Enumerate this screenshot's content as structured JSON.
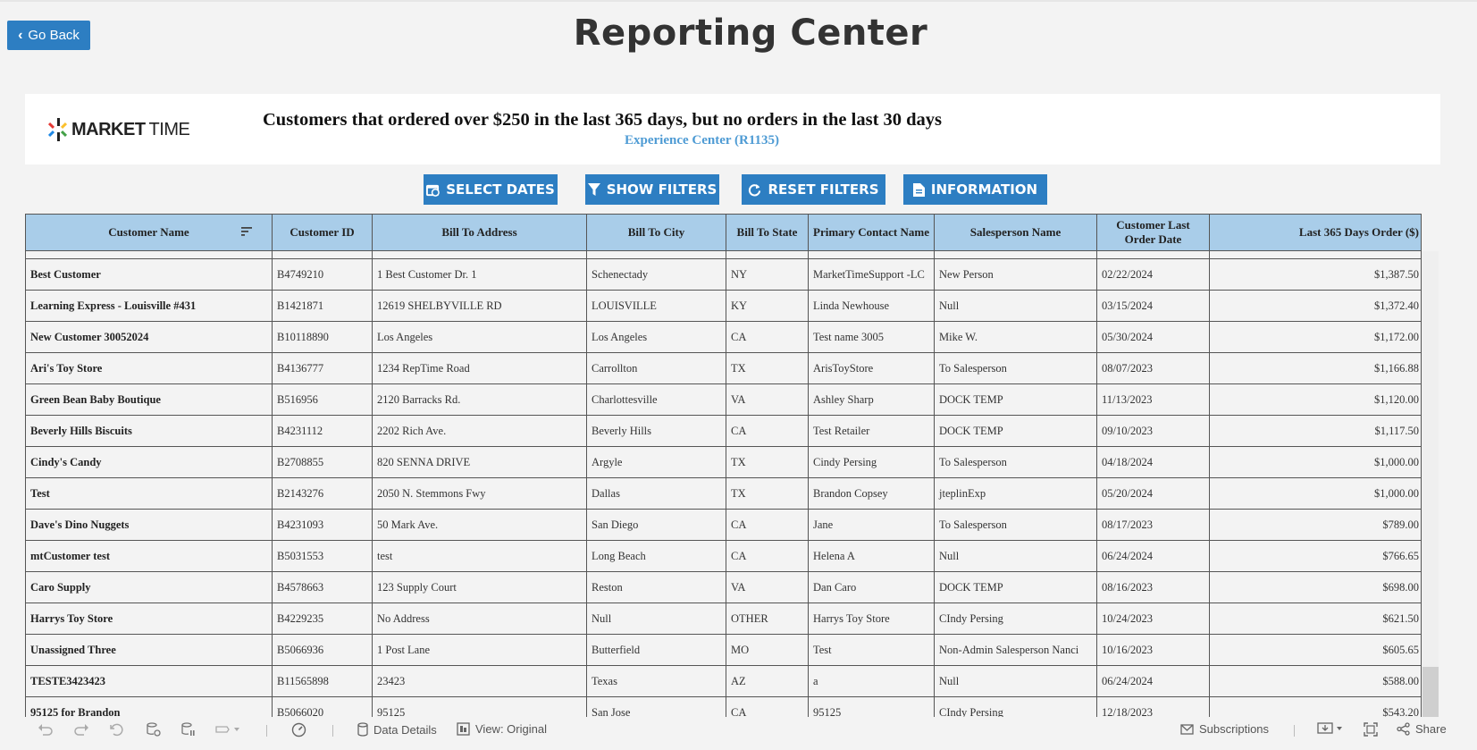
{
  "header": {
    "back_label": "Go Back",
    "title": "Reporting Center"
  },
  "banner": {
    "logo_bold": "MARKET",
    "logo_light": "TIME",
    "title": "Customers that ordered over $250 in the last 365 days, but no orders in the last 30 days",
    "subtitle": "Experience Center (R1135)"
  },
  "actions": {
    "select_dates": "SELECT DATES",
    "show_filters": "SHOW FILTERS",
    "reset_filters": "RESET FILTERS",
    "information": "INFORMATION"
  },
  "table": {
    "columns": [
      "Customer Name",
      "Customer ID",
      "Bill To Address",
      "Bill To City",
      "Bill To State",
      "Primary Contact Name",
      "Salesperson Name",
      "Customer Last Order Date",
      "Last 365 Days Order ($)"
    ],
    "rows": [
      [
        "Best Customer",
        "B4749210",
        "1 Best Customer Dr. 1",
        "Schenectady",
        "NY",
        "MarketTimeSupport -LC",
        "New Person",
        "02/22/2024",
        "$1,387.50"
      ],
      [
        "Learning Express - Louisville #431",
        "B1421871",
        "12619 SHELBYVILLE RD",
        "LOUISVILLE",
        "KY",
        "Linda  Newhouse",
        "Null",
        "03/15/2024",
        "$1,372.40"
      ],
      [
        "New Customer 30052024",
        "B10118890",
        "Los Angeles",
        "Los Angeles",
        "CA",
        "Test name  3005",
        "Mike W.",
        "05/30/2024",
        "$1,172.00"
      ],
      [
        "Ari's Toy Store",
        "B4136777",
        "1234 RepTime Road",
        "Carrollton",
        "TX",
        "ArisToyStore",
        "To Salesperson",
        "08/07/2023",
        "$1,166.88"
      ],
      [
        "Green Bean Baby Boutique",
        "B516956",
        "2120 Barracks Rd.",
        "Charlottesville",
        "VA",
        "Ashley  Sharp",
        "DOCK TEMP",
        "11/13/2023",
        "$1,120.00"
      ],
      [
        "Beverly Hills Biscuits",
        "B4231112",
        "2202 Rich Ave.",
        "Beverly Hills",
        "CA",
        "Test  Retailer",
        "DOCK TEMP",
        "09/10/2023",
        "$1,117.50"
      ],
      [
        "Cindy's Candy",
        "B2708855",
        "820 SENNA DRIVE",
        "Argyle",
        "TX",
        "Cindy  Persing",
        "To Salesperson",
        "04/18/2024",
        "$1,000.00"
      ],
      [
        "Test",
        "B2143276",
        "2050 N. Stemmons Fwy",
        "Dallas",
        "TX",
        "Brandon  Copsey",
        "jteplinExp",
        "05/20/2024",
        "$1,000.00"
      ],
      [
        "Dave's Dino Nuggets",
        "B4231093",
        "50 Mark Ave.",
        "San Diego",
        "CA",
        "Jane",
        "To Salesperson",
        "08/17/2023",
        "$789.00"
      ],
      [
        "mtCustomer test",
        "B5031553",
        "test",
        "Long Beach",
        "CA",
        "Helena  A",
        "Null",
        "06/24/2024",
        "$766.65"
      ],
      [
        "Caro Supply",
        "B4578663",
        "123 Supply Court",
        "Reston",
        "VA",
        "Dan  Caro",
        "DOCK TEMP",
        "08/16/2023",
        "$698.00"
      ],
      [
        "Harrys Toy Store",
        "B4229235",
        "No Address",
        "Null",
        "OTHER",
        "Harrys Toy Store",
        "CIndy Persing",
        "10/24/2023",
        "$621.50"
      ],
      [
        "Unassigned Three",
        "B5066936",
        "1 Post Lane",
        "Butterfield",
        "MO",
        "Test",
        "Non-Admin Salesperson Nanci",
        "10/16/2023",
        "$605.65"
      ],
      [
        "TESTE3423423",
        "B11565898",
        "23423",
        "Texas",
        "AZ",
        "a",
        "Null",
        "06/24/2024",
        "$588.00"
      ],
      [
        "95125 for Brandon",
        "B5066020",
        "95125",
        "San Jose",
        "CA",
        "95125",
        "CIndy Persing",
        "12/18/2023",
        "$543.20"
      ]
    ]
  },
  "toolbar": {
    "data_details": "Data Details",
    "view": "View: Original",
    "subscriptions": "Subscriptions",
    "share": "Share"
  },
  "colors": {
    "accent": "#2d7ec2",
    "header_bg": "#a9cde9",
    "subtitle": "#4e9bd4"
  }
}
